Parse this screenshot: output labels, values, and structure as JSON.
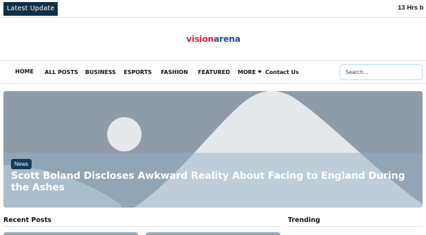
{
  "ticker": {
    "label": "Latest Update",
    "text": "13 Hrs b"
  },
  "logo": {
    "part1": "vision",
    "part2": "arena",
    "color1": "#e0233a",
    "color2": "#1c4f8f"
  },
  "nav": {
    "items": [
      {
        "label": "HOME"
      },
      {
        "label": "ALL POSTS"
      },
      {
        "label": "BUSINESS"
      },
      {
        "label": "ESPORTS"
      },
      {
        "label": "FASHION"
      },
      {
        "label": "FEATURED"
      },
      {
        "label": "MORE",
        "icon": "caret-down-icon"
      },
      {
        "label": "Contact Us"
      }
    ],
    "search_placeholder": "Search..."
  },
  "hero": {
    "tag": "News",
    "title": "Scott Boland Discloses Awkward Reality About Facing to England During the Ashes"
  },
  "sections": {
    "recent": "Recent Posts",
    "trending": "Trending"
  }
}
